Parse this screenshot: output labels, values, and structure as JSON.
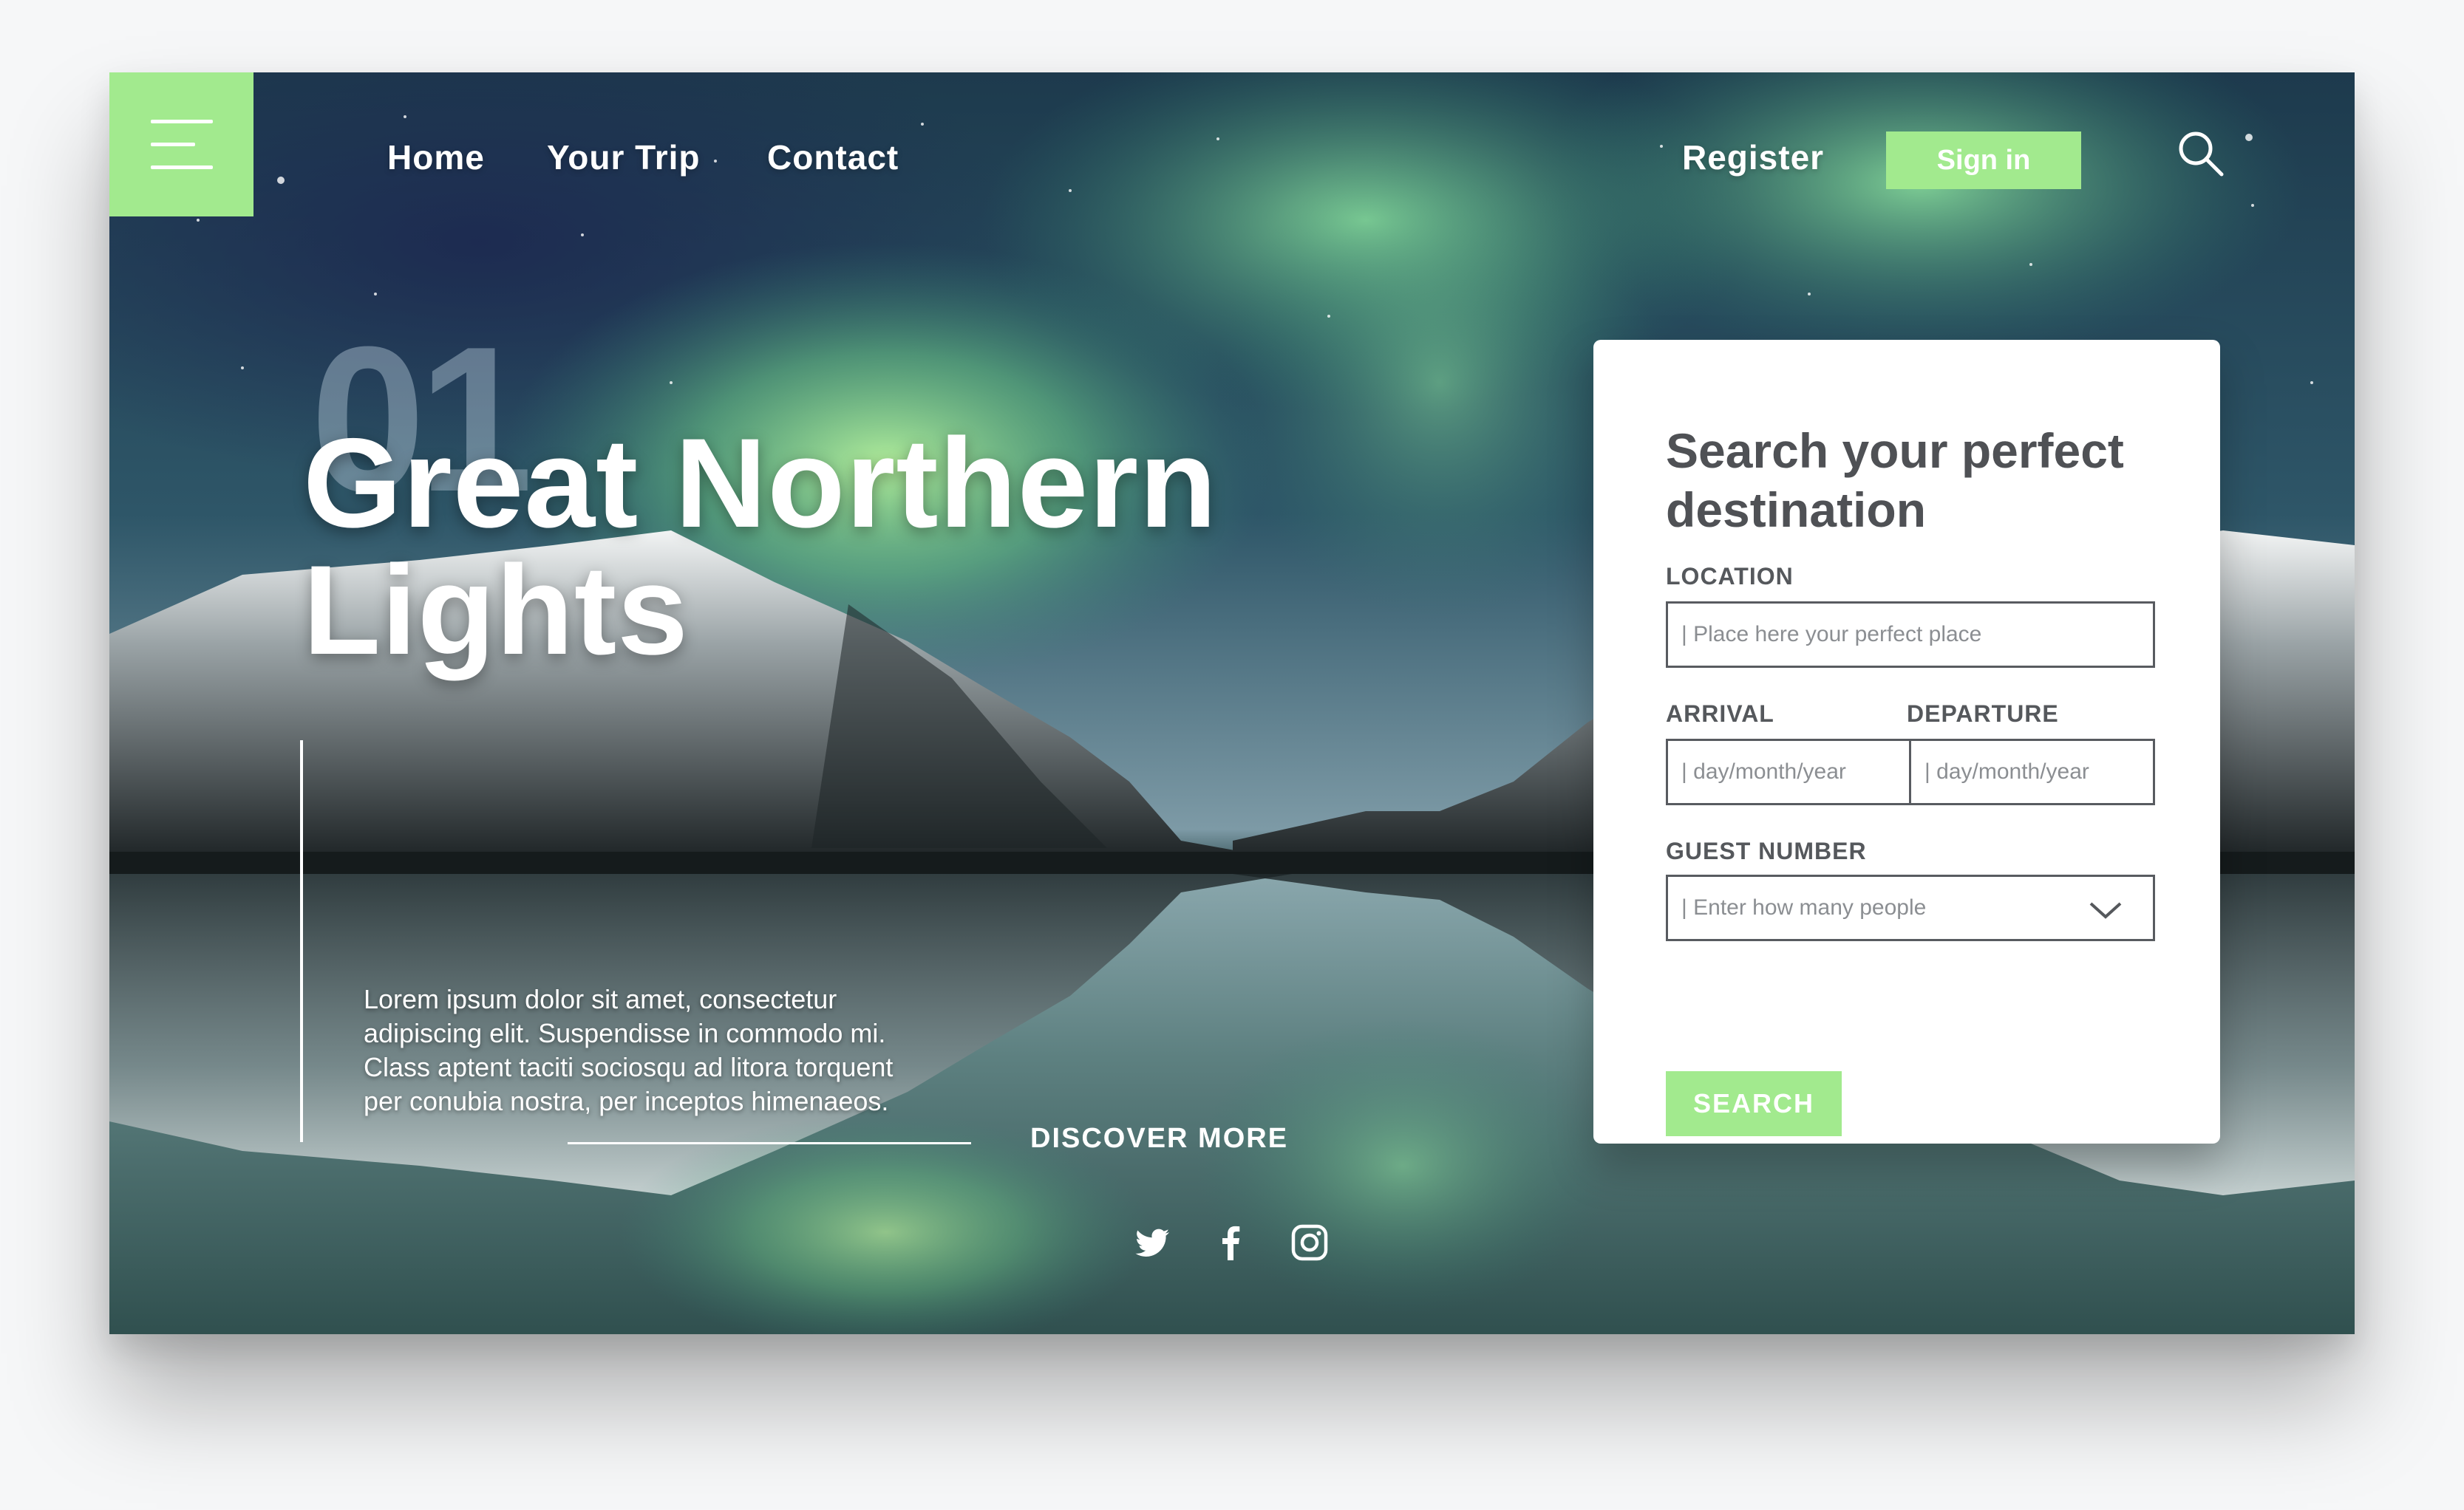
{
  "nav": {
    "menu_icon": "hamburger-icon",
    "links": [
      "Home",
      "Your Trip",
      "Contact"
    ],
    "register": "Register",
    "signin": "Sign in",
    "search_icon": "search-icon"
  },
  "hero": {
    "number": "01",
    "title_line1": "Great Northern",
    "title_line2": "Lights",
    "body": "Lorem ipsum dolor sit amet, consectetur adipiscing elit. Suspendisse in commodo mi. Class aptent taciti sociosqu ad litora torquent per conubia nostra, per inceptos himenaeos.",
    "cta": "DISCOVER MORE"
  },
  "social": [
    "twitter-icon",
    "facebook-icon",
    "instagram-icon"
  ],
  "search_card": {
    "title": "Search your perfect destination",
    "location_label": "LOCATION",
    "location_placeholder": "| Place here your perfect place",
    "arrival_label": "ARRIVAL",
    "arrival_placeholder": "| day/month/year",
    "departure_label": "DEPARTURE",
    "departure_placeholder": "| day/month/year",
    "guest_label": "GUEST NUMBER",
    "guest_placeholder": "| Enter how many people",
    "button": "SEARCH"
  },
  "colors": {
    "accent": "#a2ea8e",
    "card_text": "#4f5155",
    "white": "#ffffff"
  }
}
